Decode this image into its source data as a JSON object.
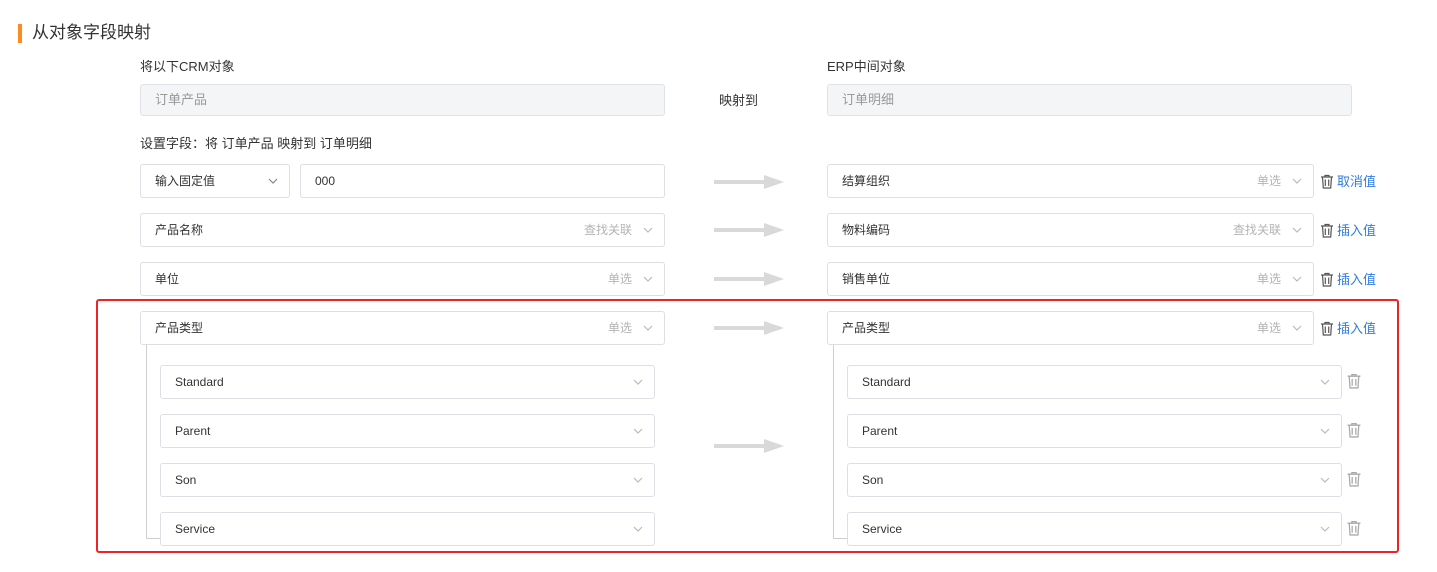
{
  "section": {
    "title": "从对象字段映射"
  },
  "header": {
    "left_label": "将以下CRM对象",
    "right_label": "ERP中间对象",
    "left_object": "订单产品",
    "mid_label": "映射到",
    "right_object": "订单明细"
  },
  "setup_label": "设置字段：将 订单产品 映射到 订单明细",
  "rows": [
    {
      "left_type": "输入固定值",
      "left_value": "000",
      "right_field": "结算组织",
      "right_hint": "单选",
      "action": "取消值"
    },
    {
      "left_field": "产品名称",
      "left_hint": "查找关联",
      "right_field": "物料编码",
      "right_hint": "查找关联",
      "action": "插入值"
    },
    {
      "left_field": "单位",
      "left_hint": "单选",
      "right_field": "销售单位",
      "right_hint": "单选",
      "action": "插入值"
    },
    {
      "left_field": "产品类型",
      "left_hint": "单选",
      "right_field": "产品类型",
      "right_hint": "单选",
      "action": "插入值"
    }
  ],
  "options": {
    "left": [
      "Standard",
      "Parent",
      "Son",
      "Service"
    ],
    "right": [
      "Standard",
      "Parent",
      "Son",
      "Service"
    ]
  },
  "colors": {
    "accent": "#ff8a1f",
    "link": "#2f7ce0",
    "highlight": "#ee2424"
  },
  "icons": {
    "trash": "trash-icon",
    "chevron": "chevron-down-icon",
    "arrow": "arrow-right-icon"
  }
}
